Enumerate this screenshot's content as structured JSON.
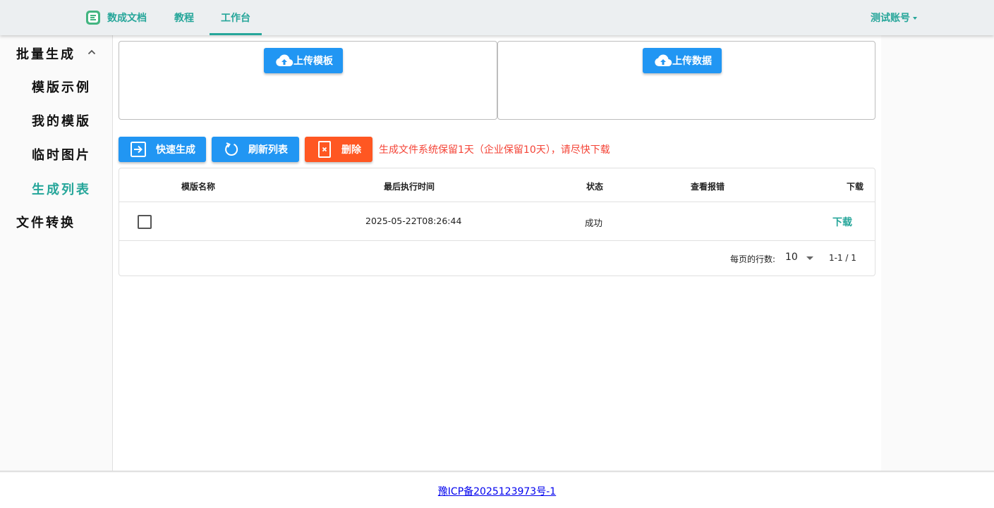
{
  "header": {
    "brand": "数成文档",
    "nav": [
      {
        "label": "教程"
      },
      {
        "label": "工作台"
      }
    ],
    "account": "测试账号",
    "accent_color": "#26a69a"
  },
  "sidebar": {
    "groups": [
      {
        "label": "批量生成",
        "expanded": true
      },
      {
        "label": "文件转换"
      }
    ],
    "items": [
      {
        "label": "模版示例"
      },
      {
        "label": "我的模版"
      },
      {
        "label": "临时图片"
      },
      {
        "label": "生成列表",
        "active": true
      }
    ]
  },
  "upload": {
    "template_label": "上传模板",
    "data_label": "上传数据"
  },
  "toolbar": {
    "quick_generate": "快速生成",
    "refresh": "刷新列表",
    "delete": "删除",
    "notice": "生成文件系统保留1天（企业保留10天），请尽快下载",
    "notice_color": "#f44336"
  },
  "table": {
    "headers": [
      "模版名称",
      "最后执行时间",
      "状态",
      "查看报错",
      "下载"
    ],
    "rows": [
      {
        "name": "",
        "time": "2025-05-22T08:26:44",
        "status": "成功",
        "error": "",
        "download": "下载"
      }
    ],
    "footer": {
      "rows_per_page_label": "每页的行数:",
      "rows_per_page": "10",
      "range": "1-1 / 1"
    }
  },
  "footer": {
    "icp": "豫ICP备2025123973号-1"
  }
}
